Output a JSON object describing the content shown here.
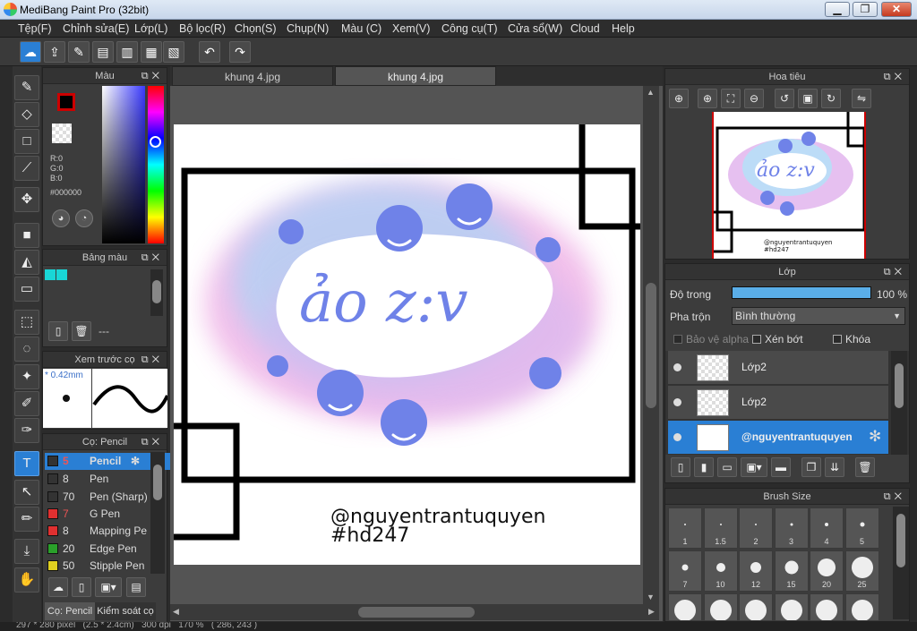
{
  "window": {
    "title": "MediBang Paint Pro (32bit)",
    "btn_min": "▁",
    "btn_max": "❐",
    "btn_close": "✕"
  },
  "menu": [
    "Tệp(F)",
    "Chỉnh sửa(E)",
    "Lớp(L)",
    "Bộ lọc(R)",
    "Chọn(S)",
    "Chụp(N)",
    "Màu (C)",
    "Xem(V)",
    "Công cụ(T)",
    "Cửa sổ(W)",
    "Cloud",
    "Help"
  ],
  "color_panel": {
    "title": "Màu",
    "r": "R:0",
    "g": "G:0",
    "b": "B:0",
    "hex": "#000000",
    "main_color": "#000000",
    "sub_color": "#b57fd6"
  },
  "palette": {
    "title": "Bảng màu",
    "swatches": [
      "#19d6d6",
      "#19d6d6"
    ],
    "footer_text": "---"
  },
  "brush_preview": {
    "title": "Xem trước cọ",
    "size": "* 0.42mm"
  },
  "brush_panel": {
    "title": "Cọ: Pencil",
    "items": [
      {
        "num": "5",
        "name": "Pencil",
        "color": "#333333",
        "selected": true
      },
      {
        "num": "8",
        "name": "Pen",
        "color": "#333333"
      },
      {
        "num": "70",
        "name": "Pen (Sharp)",
        "color": "#333333"
      },
      {
        "num": "7",
        "name": "G Pen",
        "color": "#e03030"
      },
      {
        "num": "8",
        "name": "Mapping Pe",
        "color": "#e03030"
      },
      {
        "num": "20",
        "name": "Edge Pen",
        "color": "#2aa02a"
      },
      {
        "num": "50",
        "name": "Stipple Pen",
        "color": "#e0d020"
      }
    ],
    "tab1": "Cọ: Pencil",
    "tab2": "Kiểm soát cọ"
  },
  "canvas_tabs": [
    "khung 4.jpg",
    "khung 4.jpg"
  ],
  "artwork": {
    "word": "ảo z:v",
    "watermark_line1": "@nguyentrantuquyen",
    "watermark_line2": "#hd247"
  },
  "navigator": {
    "title": "Hoa tiêu",
    "mini_word": "ảo z:v",
    "mini_line1": "@nguyentrantuquyen",
    "mini_line2": "#hd247"
  },
  "layers": {
    "title": "Lớp",
    "opacity_label": "Độ trong",
    "opacity_value": "100 %",
    "opacity": 1.0,
    "blend_label": "Pha trộn",
    "blend_value": "Bình thường",
    "protect_alpha": "Bảo vệ alpha",
    "clipping": "Xén bớt",
    "lock": "Khóa",
    "items": [
      {
        "name": "Lớp2"
      },
      {
        "name": "Lớp2"
      },
      {
        "name": "@nguyentrantuquyen",
        "selected": true
      }
    ]
  },
  "brush_size": {
    "title": "Brush Size",
    "sizes": [
      "1",
      "1.5",
      "2",
      "3",
      "4",
      "5",
      "7",
      "10",
      "12",
      "15",
      "20",
      "25",
      "",
      "",
      "",
      "",
      "",
      ""
    ]
  },
  "status_bar": "297 * 280 pixel   (2.5 * 2.4cm)   300 dpi   170 %   ( 286, 243 )"
}
